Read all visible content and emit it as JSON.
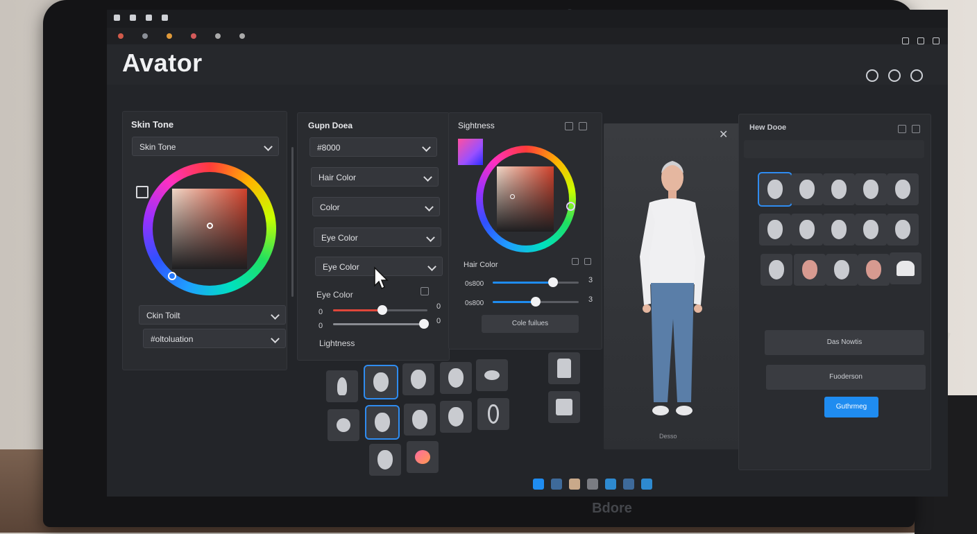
{
  "browser": {
    "tabs": [
      "",
      "",
      "",
      ""
    ],
    "tab_labels": [
      "",
      "",
      "",
      "",
      "",
      ""
    ]
  },
  "app": {
    "title": "Avator"
  },
  "skin_panel": {
    "title": "Skin Tone",
    "dropdown_top": "Skin Tone",
    "dropdown_bottom_1": "Ckin Toilt",
    "dropdown_bottom_2": "#oltoluation"
  },
  "color_panel": {
    "title": "Gupn Doea",
    "dropdowns": [
      "#8000",
      "Hair Color",
      "Color",
      "Eye Color",
      "Eye Color"
    ],
    "eye_color_label": "Eye Color",
    "slider_rows": [
      {
        "left": "0",
        "right": "0",
        "value": 0.52,
        "color": "#e0473a"
      },
      {
        "left": "0",
        "right": "0",
        "value": 0.96,
        "color": "#8a8c92"
      }
    ],
    "lightness_label": "Lightness"
  },
  "sightness_panel": {
    "title": "Sightness",
    "hair_color_label": "Hair Color",
    "slider_rows": [
      {
        "left": "0s800",
        "right": "3",
        "value": 0.7,
        "color": "#1f8cf0"
      },
      {
        "left": "0s800",
        "right": "3",
        "value": 0.5,
        "color": "#1f8cf0"
      }
    ],
    "button": "Cole fuilues"
  },
  "preview": {
    "caption": "Desso"
  },
  "library": {
    "title": "Hew Dooe",
    "buttons": [
      "Das Nowtis",
      "Fuoderson",
      "Guthrmeg"
    ]
  },
  "bezel": {
    "brand": "Bdore"
  },
  "colors": {
    "accent": "#1f8cf0",
    "background": "#232529",
    "panel": "#2a2c30"
  }
}
